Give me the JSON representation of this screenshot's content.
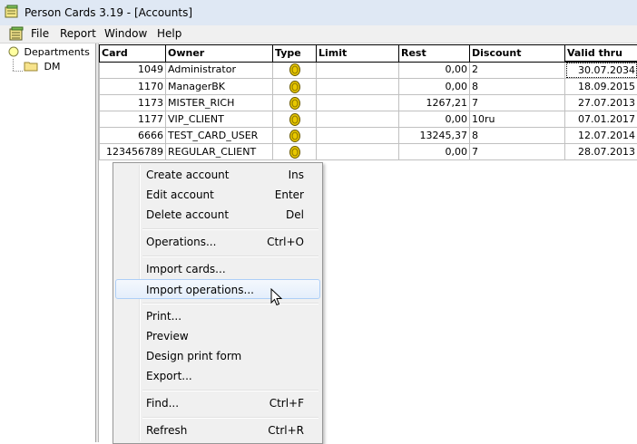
{
  "window": {
    "title": "Person Cards 3.19 - [Accounts]",
    "app_icon": "cards-app-icon"
  },
  "menubar": {
    "icon": "document-cards-icon",
    "items": [
      {
        "label": "File"
      },
      {
        "label": "Report"
      },
      {
        "label": "Window"
      },
      {
        "label": "Help"
      }
    ]
  },
  "tree": {
    "root_label": "Departments",
    "child_label": "DM"
  },
  "grid": {
    "columns": [
      "Card",
      "Owner",
      "Type",
      "Limit",
      "Rest",
      "Discount",
      "Valid thru"
    ],
    "rows": [
      {
        "card": "1049",
        "owner": "Administrator",
        "type": "coin-icon",
        "limit": "",
        "rest": "0,00",
        "discount": "2",
        "valid": "30.07.2034"
      },
      {
        "card": "1170",
        "owner": "ManagerBK",
        "type": "coin-icon",
        "limit": "",
        "rest": "0,00",
        "discount": "8",
        "valid": "18.09.2015"
      },
      {
        "card": "1173",
        "owner": "MISTER_RICH",
        "type": "coin-icon",
        "limit": "",
        "rest": "1267,21",
        "discount": "7",
        "valid": "27.07.2013"
      },
      {
        "card": "1177",
        "owner": "VIP_CLIENT",
        "type": "coin-icon",
        "limit": "",
        "rest": "0,00",
        "discount": "10ru",
        "valid": "07.01.2017"
      },
      {
        "card": "6666",
        "owner": "TEST_CARD_USER",
        "type": "coin-icon",
        "limit": "",
        "rest": "13245,37",
        "discount": "8",
        "valid": "12.07.2014"
      },
      {
        "card": "123456789",
        "owner": "REGULAR_CLIENT",
        "type": "coin-icon",
        "limit": "",
        "rest": "0,00",
        "discount": "7",
        "valid": "28.07.2013"
      }
    ]
  },
  "context_menu": {
    "items": [
      {
        "label": "Create account",
        "shortcut": "Ins"
      },
      {
        "label": "Edit account",
        "shortcut": "Enter"
      },
      {
        "label": "Delete account",
        "shortcut": "Del"
      },
      {
        "label": "Operations...",
        "shortcut": "Ctrl+O"
      },
      {
        "label": "Import cards...",
        "shortcut": ""
      },
      {
        "label": "Import operations...",
        "shortcut": ""
      },
      {
        "label": "Print...",
        "shortcut": ""
      },
      {
        "label": "Preview",
        "shortcut": ""
      },
      {
        "label": "Design print form",
        "shortcut": ""
      },
      {
        "label": "Export...",
        "shortcut": ""
      },
      {
        "label": "Find...",
        "shortcut": "Ctrl+F"
      },
      {
        "label": "Refresh",
        "shortcut": "Ctrl+R"
      }
    ]
  },
  "colors": {
    "title_bar": "#dfe8f4",
    "menu_hover_border": "#aecff7",
    "coin": "#e8c800"
  }
}
